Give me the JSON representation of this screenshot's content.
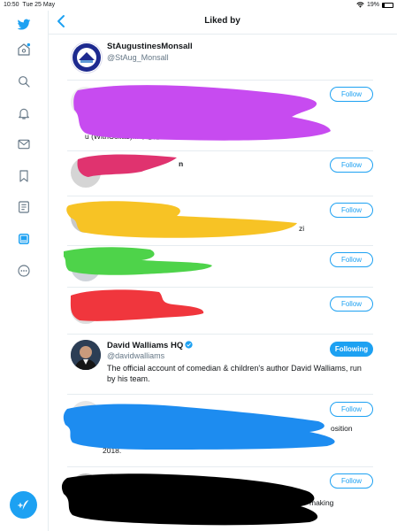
{
  "status_bar": {
    "time": "10:50",
    "date": "Tue 25 May",
    "battery": "19%",
    "battery_level": 0.19
  },
  "sidebar": {
    "icons": [
      "twitter-logo",
      "home-icon",
      "search-icon",
      "notifications-icon",
      "messages-icon",
      "bookmarks-icon",
      "lists-icon",
      "profile-icon",
      "more-icon"
    ],
    "compose_icon": "compose-tweet-icon"
  },
  "header": {
    "title": "Liked by"
  },
  "users": [
    {
      "name": "StAugustinesMonsall",
      "handle": "@StAug_Monsall",
      "bio": "",
      "button": ""
    },
    {
      "name": "",
      "handle": "",
      "bio": "",
      "button": "Follow",
      "fragment": "u (WithCollab)...の思返"
    },
    {
      "name": "",
      "handle": "",
      "bio": "",
      "button": "Follow",
      "fragment": "n"
    },
    {
      "name": "",
      "handle": "",
      "bio": "",
      "button": "Follow",
      "fragment": "zi"
    },
    {
      "name": "",
      "handle": "",
      "bio": "",
      "button": "Follow",
      "fragment": ""
    },
    {
      "name": "",
      "handle": "",
      "bio": "",
      "button": "Follow",
      "fragment": ""
    },
    {
      "name": "David Walliams HQ",
      "handle": "@davidwalliams",
      "bio": "The official account of comedian & children's author David Walliams, run by his team.",
      "button": "Following",
      "verified": true
    },
    {
      "name": "",
      "handle": "",
      "bio": "",
      "button": "Follow",
      "fragment": "osition",
      "fragment2": "2018."
    },
    {
      "name": "",
      "handle": "",
      "bio": "",
      "button": "Follow",
      "fragment": "making"
    }
  ],
  "colors": {
    "accent": "#1da1f2",
    "redaction_purple": "#c74bf0",
    "redaction_pink": "#e0336f",
    "redaction_yellow": "#f7c325",
    "redaction_green": "#4ed34a",
    "redaction_red": "#f0363d",
    "redaction_blue": "#1d8cf0",
    "redaction_black": "#000000"
  }
}
